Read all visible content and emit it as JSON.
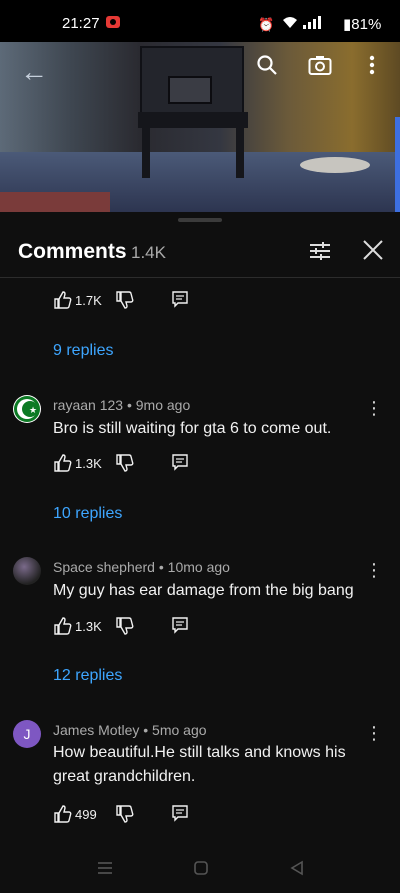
{
  "status_bar": {
    "time": "21:27",
    "battery": "81%",
    "icons": [
      "alarm-icon",
      "wifi-icon",
      "signal-icon",
      "battery-icon"
    ]
  },
  "video": {
    "icons": [
      "back-arrow-icon",
      "search-icon",
      "camera-icon",
      "more-vert-icon"
    ]
  },
  "comments_panel": {
    "title": "Comments",
    "count": "1.4K"
  },
  "comments": [
    {
      "likes": "1.7K",
      "replies": "9 replies"
    },
    {
      "author": "rayaan 123",
      "age": "9mo ago",
      "text": "Bro is still waiting for gta 6 to come out.",
      "likes": "1.3K",
      "replies": "10 replies"
    },
    {
      "author": "Space shepherd",
      "age": "10mo ago",
      "text": "My guy has ear damage from the big bang",
      "likes": "1.3K",
      "replies": "12 replies"
    },
    {
      "author": "James Motley",
      "age": "5mo ago",
      "avatar_letter": "J",
      "text": "How beautiful.He still talks and knows his great grandchildren.",
      "likes": "499"
    }
  ],
  "colors": {
    "background": "#0f0f0f",
    "link": "#3ea6ff",
    "avatar_j": "#7e57c2"
  }
}
